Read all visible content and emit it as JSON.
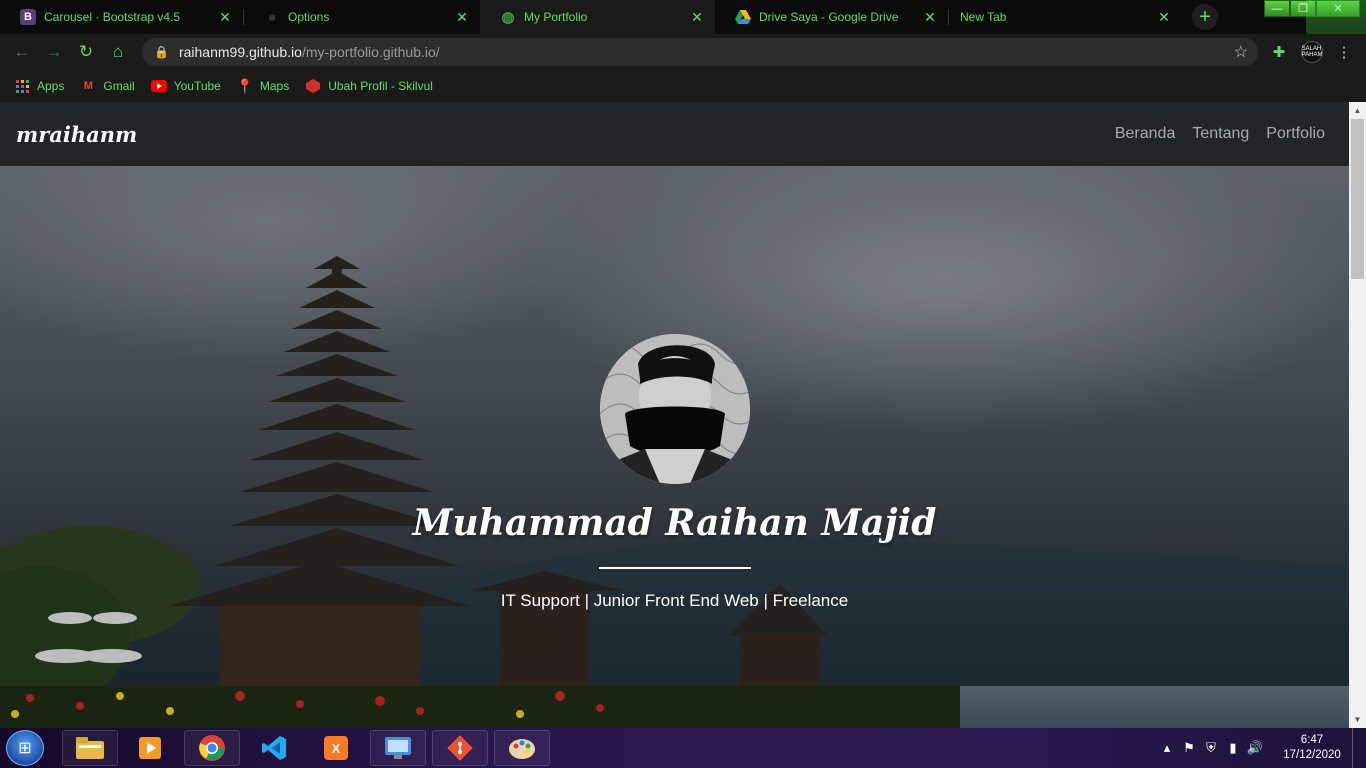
{
  "browser": {
    "tabs": [
      {
        "label": "Carousel · Bootstrap v4.5",
        "favicon": "bootstrap-icon",
        "active": false
      },
      {
        "label": "Options",
        "favicon": "github-icon",
        "active": false
      },
      {
        "label": "My Portfolio",
        "favicon": "globe-icon",
        "active": true
      },
      {
        "label": "Drive Saya - Google Drive",
        "favicon": "google-drive-icon",
        "active": false
      },
      {
        "label": "New Tab",
        "favicon": "",
        "active": false
      }
    ],
    "new_tab": "+",
    "window_controls": {
      "minimize": "—",
      "restore": "❐",
      "close": "✕"
    },
    "address": {
      "host": "raihanm99.github.io",
      "path": "/my-portfolio.github.io/"
    },
    "bookmarks": [
      {
        "label": "Apps",
        "icon": "apps-grid-icon"
      },
      {
        "label": "Gmail",
        "icon": "gmail-icon"
      },
      {
        "label": "YouTube",
        "icon": "youtube-icon"
      },
      {
        "label": "Maps",
        "icon": "maps-icon"
      },
      {
        "label": "Ubah Profil - Skilvul",
        "icon": "skilvul-icon"
      }
    ],
    "profile_text": "SALAH PAHAM",
    "theme_color": "#5fe05f"
  },
  "site": {
    "brand": "mraihanm",
    "nav": [
      "Beranda",
      "Tentang",
      "Portfolio"
    ],
    "hero": {
      "name": "Muhammad Raihan Majid",
      "subtitle": "IT Support | Junior Front End Web | Freelance"
    }
  },
  "taskbar": {
    "apps": [
      "file-explorer-icon",
      "media-player-icon",
      "chrome-icon",
      "vscode-icon",
      "xampp-icon",
      "control-panel-icon",
      "git-icon",
      "paint-icon"
    ],
    "clock": {
      "time": "6:47",
      "date": "17/12/2020"
    }
  }
}
